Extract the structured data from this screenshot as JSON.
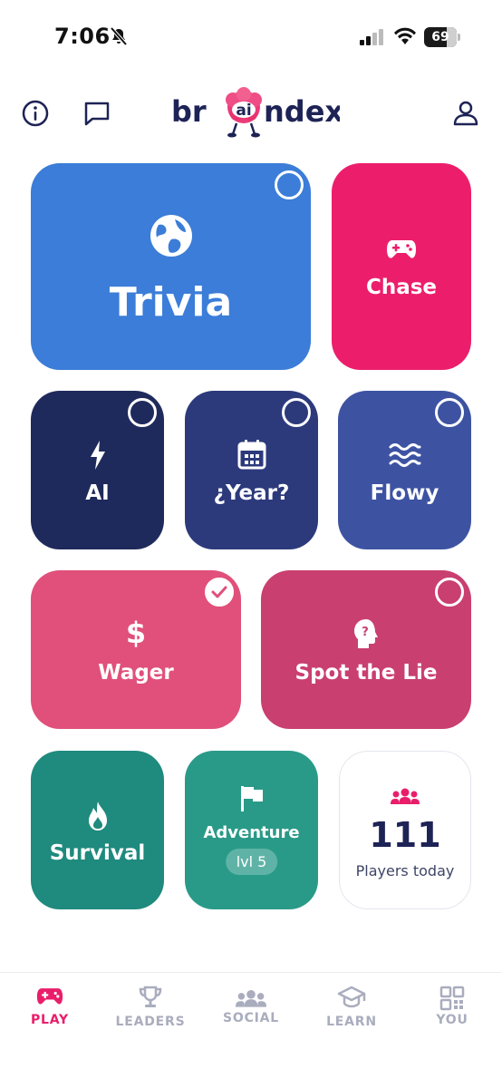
{
  "status_bar": {
    "time": "7:06",
    "battery": "69",
    "battery_level": 0.69
  },
  "header": {
    "logo_text": "brаindex",
    "logo_prefix": "br",
    "logo_suffix": "ndex"
  },
  "tiles": {
    "trivia": {
      "label": "Trivia",
      "color": "#3b7dd8",
      "selected": false
    },
    "chase": {
      "label": "Chase",
      "color": "#ec1e6b"
    },
    "ai": {
      "label": "AI",
      "color": "#1f2a5c",
      "selected": false
    },
    "year": {
      "label": "¿Year?",
      "color": "#2c3a7c",
      "selected": false
    },
    "flowy": {
      "label": "Flowy",
      "color": "#3d53a2",
      "selected": false
    },
    "wager": {
      "label": "Wager",
      "color": "#e0507a",
      "selected": true
    },
    "spot_the_lie": {
      "label": "Spot the Lie",
      "color": "#c93f70",
      "selected": false
    },
    "survival": {
      "label": "Survival",
      "color": "#1f8a7e"
    },
    "adventure": {
      "label": "Adventure",
      "level": "lvl 5",
      "color": "#2a9a88"
    },
    "players": {
      "count": "111",
      "label": "Players today"
    }
  },
  "tabbar": {
    "tabs": [
      {
        "label": "PLAY",
        "icon": "gamepad-icon",
        "active": true
      },
      {
        "label": "LEADERS",
        "icon": "trophy-icon",
        "active": false
      },
      {
        "label": "SOCIAL",
        "icon": "people-icon",
        "active": false
      },
      {
        "label": "LEARN",
        "icon": "graduation-cap-icon",
        "active": false
      },
      {
        "label": "YOU",
        "icon": "grid-icon",
        "active": false
      }
    ]
  },
  "colors": {
    "accent": "#e91e6b",
    "navy": "#1e2356",
    "inactive": "#a9adbd"
  }
}
